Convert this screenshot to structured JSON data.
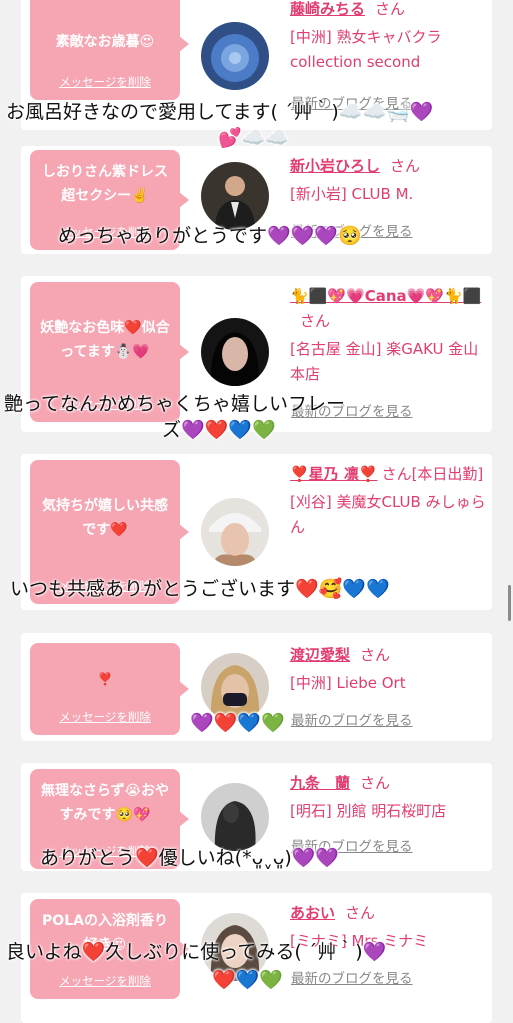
{
  "common": {
    "delete_label": "メッセージを削除",
    "blog_label": "最新のブログを見る",
    "san": "さん"
  },
  "cards": [
    {
      "message": "素敵なお歳暮😍",
      "name": "藤崎みちる",
      "shop": "[中洲] 熟女キャバクラ collection second",
      "avatar": "blue-rose"
    },
    {
      "message": "しおりさん紫ドレス超セクシー✌️",
      "name": "新小岩ひろし",
      "shop": "[新小岩] CLUB M.",
      "avatar": "man-suit"
    },
    {
      "message": "妖艶なお色味❤️似合ってます☃️💗",
      "name": "🐈⬛💖💗Cana💗💖🐈⬛",
      "shop": "[名古屋 金山] 楽GAKU 金山本店",
      "avatar": "dark-woman"
    },
    {
      "message": "気持ちが嬉しい共感です❤️",
      "name": "❣️星乃 凛❣️",
      "name_suffix": "さん[本日出勤]",
      "shop": "[刈谷] 美魔女CLUB みしゅらん",
      "avatar": "woman-hat"
    },
    {
      "message": "❣️",
      "name": "渡辺愛梨",
      "shop": "[中洲] Liebe Ort",
      "avatar": "woman-mask"
    },
    {
      "message": "無理なさらず😭おやすみです🥺💖",
      "name": "九条　蘭",
      "shop": "[明石] 別館 明石桜町店",
      "avatar": "dark-figure"
    },
    {
      "message": "POLAの入浴剤香り好き😍",
      "name": "あおい",
      "shop": "[ミナミ] Mrs.ミナミ",
      "avatar": "woman-light"
    }
  ],
  "overlays": [
    "お風呂好きなので愛用してます( ´艸｀)☁️☁️🛁💜",
    "💕☁️☁️",
    "めっちゃありがとうです💜💜💜🥺",
    "艶ってなんかめちゃくちゃ嬉しいフレー",
    "ズ💜❤️💙💚",
    "いつも共感ありがとうございます❤️🥰💙💙",
    "💜❤️💙💚",
    "ありがとう❤️優しいね(*ᴗ͈ˬᴗ͈)💜💜",
    "良いよね❤️久しぶりに使ってみる( ´艸｀)💜",
    "❤️💙💚"
  ],
  "colors": {
    "bubble": "#f6a5b3",
    "link_pink": "#e23d70",
    "background": "#f1f1f1"
  }
}
